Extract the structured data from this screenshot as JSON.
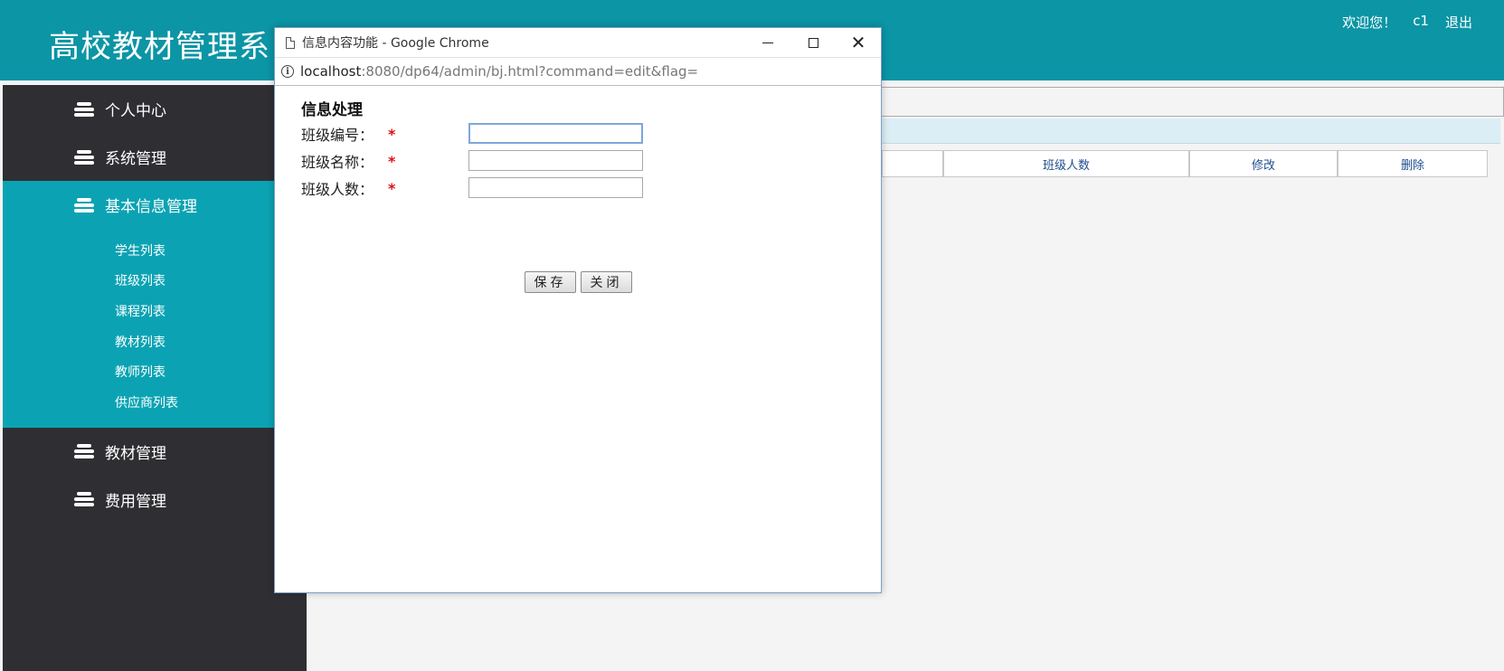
{
  "header": {
    "title": "高校教材管理系",
    "welcome": "欢迎您！",
    "username": "c1",
    "logout": "退出"
  },
  "sidebar": {
    "groups": [
      {
        "label": "个人中心"
      },
      {
        "label": "系统管理"
      },
      {
        "label": "基本信息管理"
      },
      {
        "label": "教材管理"
      },
      {
        "label": "费用管理"
      }
    ],
    "submenu": [
      "学生列表",
      "班级列表",
      "课程列表",
      "教材列表",
      "教师列表",
      "供应商列表"
    ]
  },
  "table": {
    "headers": [
      "班级人数",
      "修改",
      "删除"
    ]
  },
  "popup": {
    "window_title": "信息内容功能 - Google Chrome",
    "url_host": "localhost",
    "url_path": ":8080/dp64/admin/bj.html?command=edit&flag=",
    "form_title": "信息处理",
    "fields": [
      {
        "label": "班级编号：",
        "required": "*",
        "value": ""
      },
      {
        "label": "班级名称：",
        "required": "*",
        "value": ""
      },
      {
        "label": "班级人数：",
        "required": "*",
        "value": ""
      }
    ],
    "save_label": "保存",
    "close_label": "关闭"
  },
  "colors": {
    "header_bg": "#0b95a5",
    "sidebar_bg": "#2f2f33",
    "active_bg": "#0ba3b3",
    "required": "#dd1111"
  },
  "icons": {
    "menu_group": "stack-icon",
    "window_page": "document-icon",
    "address_info": "info-icon"
  }
}
